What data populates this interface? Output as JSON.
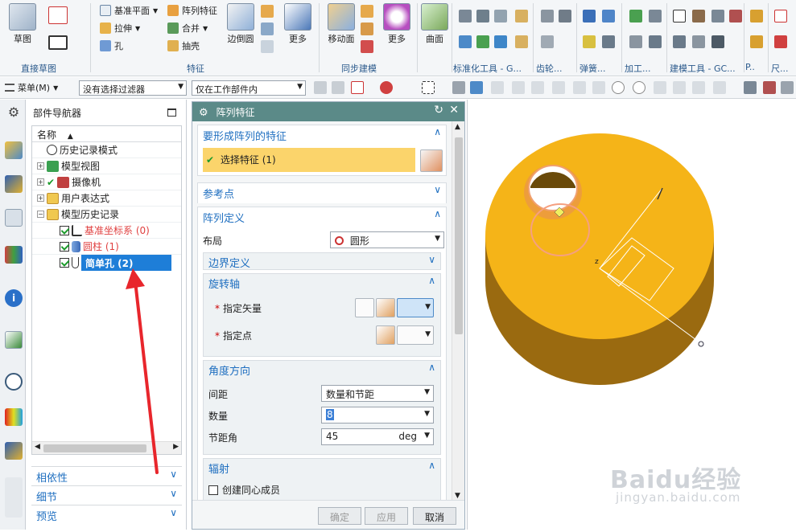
{
  "ribbon": {
    "sketch_label": "草图",
    "direct_sketch_group": "直接草图",
    "datum_plane": "基准平面",
    "extrude": "拉伸",
    "hole": "孔",
    "pattern_feature": "阵列特征",
    "unite": "合并",
    "shell": "抽壳",
    "edge_blend": "边倒圆",
    "more1": "更多",
    "feature_group": "特征",
    "move_face": "移动面",
    "more2": "更多",
    "sync_group": "同步建模",
    "surface": "曲面",
    "std_tools_group": "标准化工具 - G...",
    "gear_group": "齿轮...",
    "spring_group": "弹簧...",
    "machining_group": "加工...",
    "modeling_tools_group": "建模工具 - GC...",
    "dim_group": "尺...",
    "p_group": "P.."
  },
  "toolbar": {
    "menu_label": "菜单(M)",
    "filter_value": "没有选择过滤器",
    "scope_value": "仅在工作部件内"
  },
  "navigator": {
    "title": "部件导航器",
    "column_name": "名称",
    "items": [
      {
        "label": "历史记录模式",
        "color": "#222"
      },
      {
        "label": "模型视图",
        "color": "#222"
      },
      {
        "label": "摄像机",
        "color": "#222"
      },
      {
        "label": "用户表达式",
        "color": "#222"
      },
      {
        "label": "模型历史记录",
        "color": "#222"
      },
      {
        "label": "基准坐标系 (0)",
        "color": "#e04040"
      },
      {
        "label": "圆柱 (1)",
        "color": "#e04040"
      },
      {
        "label": "简单孔 (2)",
        "color": "#ffffff"
      }
    ],
    "dependency": "相依性",
    "details": "细节",
    "preview": "预览"
  },
  "dialog": {
    "title": "阵列特征",
    "sec_features": "要形成阵列的特征",
    "select_feature": "选择特征 (1)",
    "sec_reference": "参考点",
    "sec_definition": "阵列定义",
    "layout_label": "布局",
    "layout_value": "圆形",
    "boundary": "边界定义",
    "rotation_axis": "旋转轴",
    "specify_vector": "指定矢量",
    "specify_point": "指定点",
    "angle_direction": "角度方向",
    "spacing_label": "间距",
    "spacing_value": "数量和节距",
    "count_label": "数量",
    "count_value": "8",
    "pitch_label": "节距角",
    "pitch_value": "45",
    "pitch_unit": "deg",
    "radiation": "辐射",
    "create_concentric": "创建同心成员",
    "ok": "确定",
    "apply": "应用",
    "cancel": "取消"
  },
  "colors": {
    "accent": "#1f6fc0",
    "selection": "#1e7ed8",
    "highlight_bar": "#fbd46b",
    "part_color": "#f5b418",
    "dialog_title_bg": "#5b8a88"
  },
  "watermark": {
    "brand": "Baidu经验",
    "url": "jingyan.baidu.com"
  }
}
